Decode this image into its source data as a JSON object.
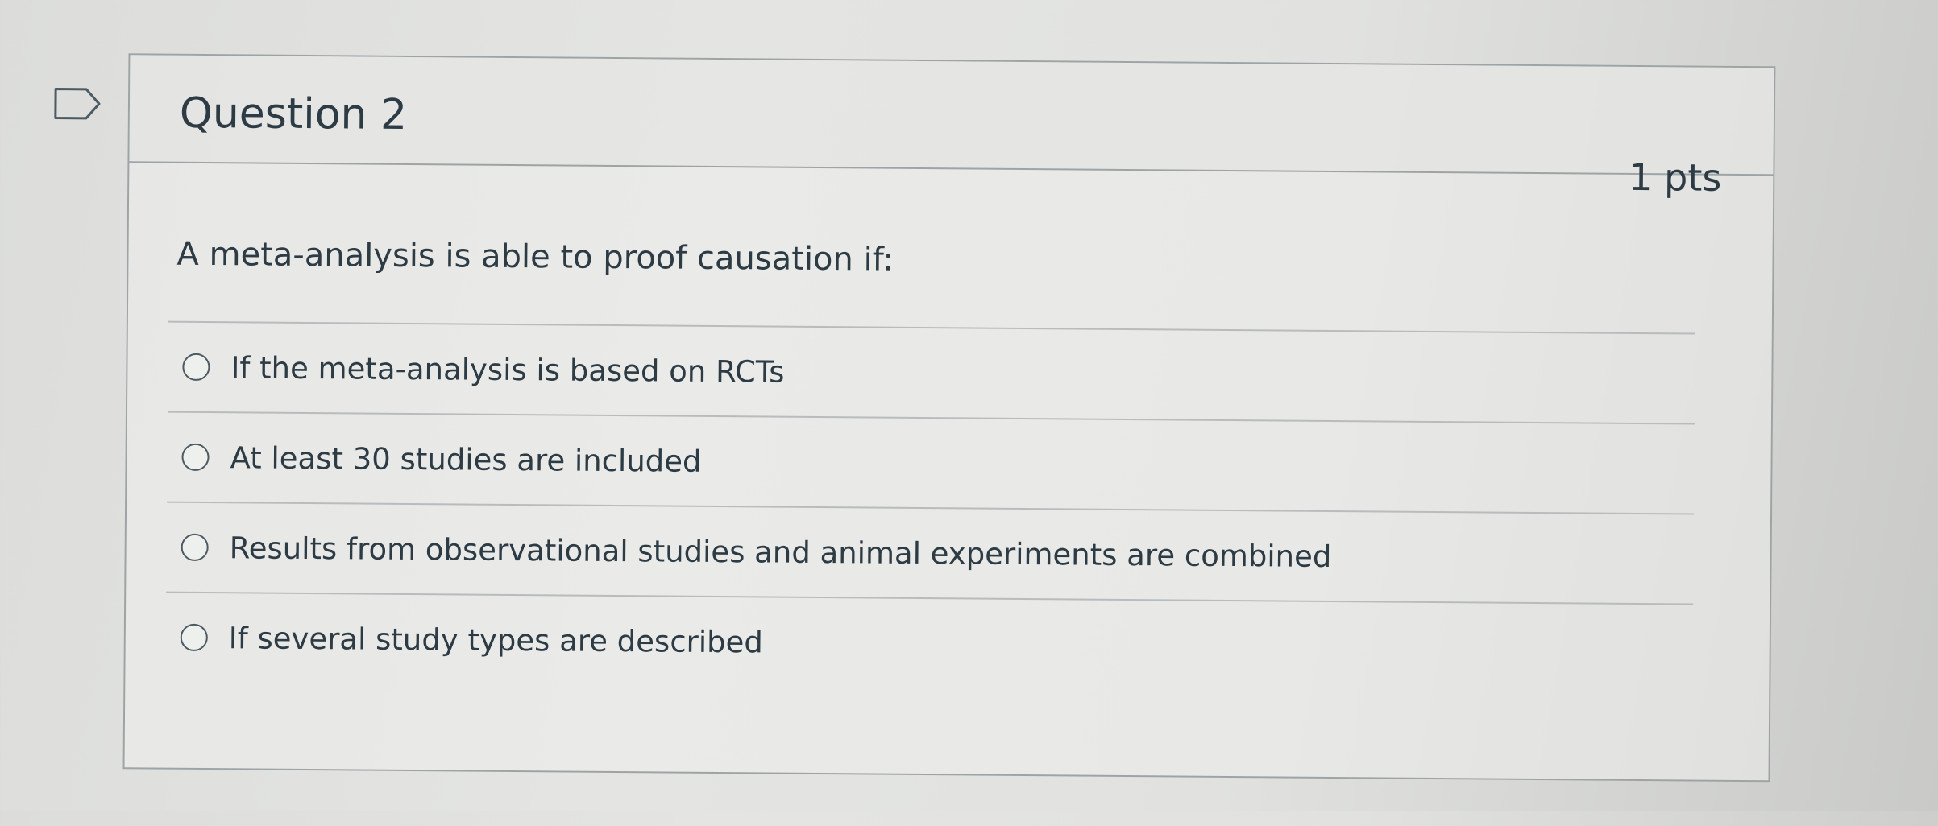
{
  "question": {
    "title": "Question 2",
    "points": "1 pts",
    "text": "A meta-analysis is able to proof causation if:"
  },
  "answers": [
    {
      "label": "If the meta-analysis is based on RCTs",
      "selected": false
    },
    {
      "label": "At least 30 studies are included",
      "selected": false
    },
    {
      "label": "Results from observational studies and animal experiments are combined",
      "selected": false
    },
    {
      "label": "If several study types are described",
      "selected": false
    }
  ],
  "icons": {
    "flag": "bookmark-flag-icon",
    "radio": "radio-button-icon"
  },
  "colors": {
    "text": "#2d3b45",
    "border": "#9ea4a6"
  }
}
